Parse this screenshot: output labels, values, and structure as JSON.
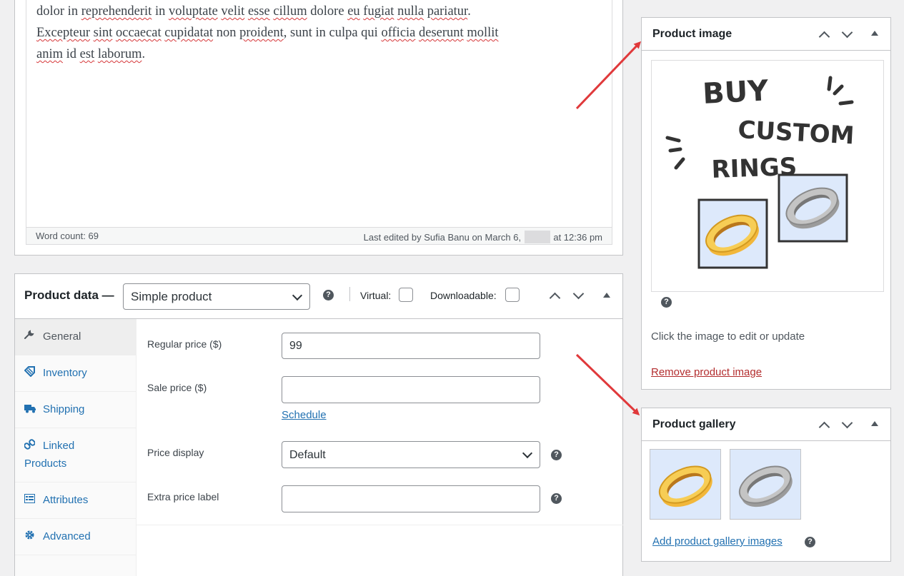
{
  "editor": {
    "line1_a": "dolor in ",
    "line1_w1": "reprehenderit",
    "line1_b": " in ",
    "line1_w2": "voluptate",
    "line1_c": " ",
    "line1_w3": "velit",
    "line1_d": " ",
    "line1_w4": "esse",
    "line1_e": " ",
    "line1_w5": "cillum",
    "line1_f": " dolore ",
    "line1_w6": "eu",
    "line1_g": " ",
    "line1_w7": "fugiat",
    "line1_h": " ",
    "line1_w8": "nulla",
    "line1_i": " ",
    "line1_w9": "pariatur",
    "line1_j": ".",
    "line2_w1": "Excepteur",
    "line2_a": " ",
    "line2_w2": "sint",
    "line2_b": " ",
    "line2_w3": "occaecat",
    "line2_c": " ",
    "line2_w4": "cupidatat",
    "line2_d": " non ",
    "line2_w5": "proident",
    "line2_e": ", sunt in culpa qui ",
    "line2_w6": "officia",
    "line2_f": " ",
    "line2_w7": "deserunt",
    "line2_g": " ",
    "line2_w8": "mollit",
    "line3_w1": "anim",
    "line3_a": " id ",
    "line3_w2": "est",
    "line3_b": " ",
    "line3_w3": "laborum",
    "line3_c": ".",
    "word_count": "Word count: 69",
    "last_edited_prefix": "Last edited by Sufia Banu on March 6,",
    "last_edited_suffix": "at 12:36 pm"
  },
  "product_data": {
    "title": "Product data —",
    "type_select": "Simple product",
    "virtual_label": "Virtual:",
    "downloadable_label": "Downloadable:",
    "tabs": [
      {
        "label": "General",
        "icon": "wrench-icon"
      },
      {
        "label": "Inventory",
        "icon": "tag-icon"
      },
      {
        "label": "Shipping",
        "icon": "truck-icon"
      },
      {
        "label": "Linked",
        "label2": "Products",
        "icon": "link-icon"
      },
      {
        "label": "Attributes",
        "icon": "list-icon"
      },
      {
        "label": "Advanced",
        "icon": "gear-icon"
      }
    ],
    "regular_price_label": "Regular price ($)",
    "regular_price_value": "99",
    "sale_price_label": "Sale price ($)",
    "sale_price_value": "",
    "schedule_link": "Schedule",
    "price_display_label": "Price display",
    "price_display_value": "Default",
    "extra_price_label": "Extra price label",
    "extra_price_value": ""
  },
  "product_image": {
    "title": "Product image",
    "img_text1": "BUY",
    "img_text2": "CUSTOM",
    "img_text3": "RINGS",
    "hint": "Click the image to edit or update",
    "remove_link": "Remove product image"
  },
  "product_gallery": {
    "title": "Product gallery",
    "add_link": "Add product gallery images"
  },
  "colors": {
    "accent": "#2271b1",
    "danger": "#b32d2e",
    "arrow": "#e0393b",
    "gold": "#f2b73a",
    "silver": "#a7a7a7"
  }
}
